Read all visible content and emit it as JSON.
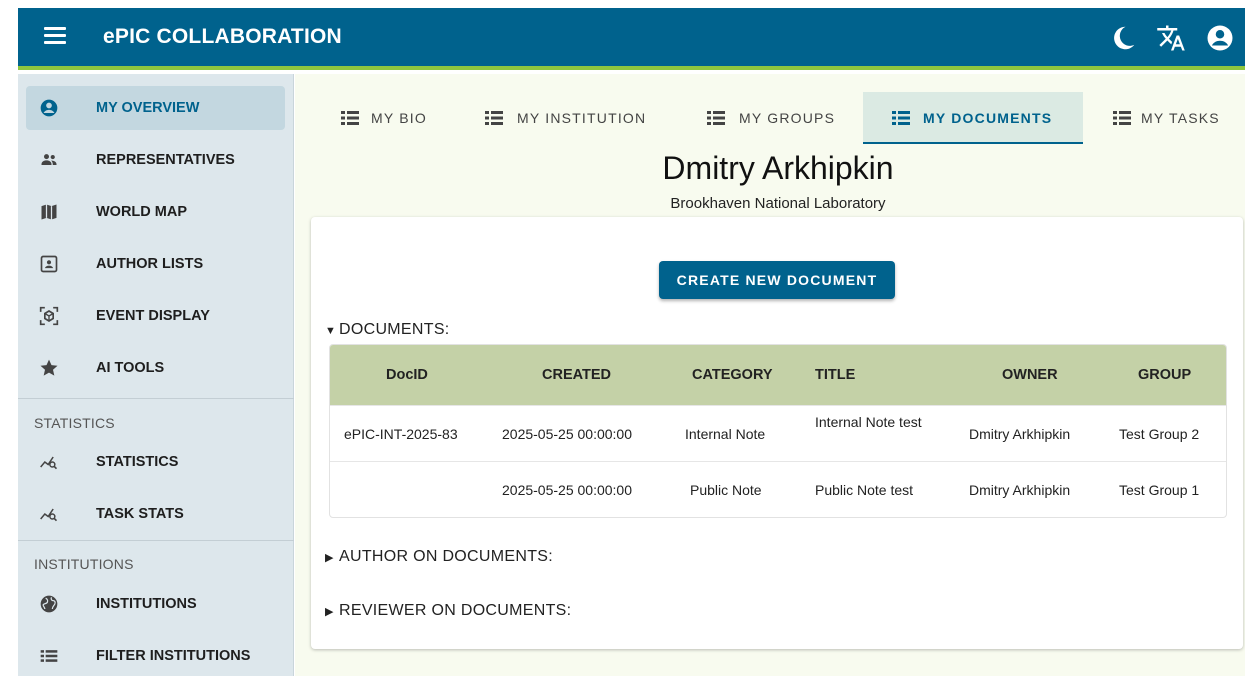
{
  "app": {
    "title": "ePIC COLLABORATION"
  },
  "topbar": {
    "icons": [
      "menu-icon",
      "moon-icon",
      "translate-icon",
      "account-icon"
    ]
  },
  "sidebar": {
    "items": [
      {
        "label": "MY OVERVIEW",
        "icon": "account-circle-icon",
        "active": true
      },
      {
        "label": "REPRESENTATIVES",
        "icon": "people-icon"
      },
      {
        "label": "WORLD MAP",
        "icon": "map-icon"
      },
      {
        "label": "AUTHOR LISTS",
        "icon": "contact-card-icon"
      },
      {
        "label": "EVENT DISPLAY",
        "icon": "cube-scan-icon"
      },
      {
        "label": "AI TOOLS",
        "icon": "star-icon"
      }
    ],
    "sections": [
      {
        "title": "STATISTICS",
        "items": [
          {
            "label": "STATISTICS",
            "icon": "chart-search-icon"
          },
          {
            "label": "TASK STATS",
            "icon": "chart-search-icon"
          }
        ]
      },
      {
        "title": "INSTITUTIONS",
        "items": [
          {
            "label": "INSTITUTIONS",
            "icon": "globe-icon"
          },
          {
            "label": "FILTER INSTITUTIONS",
            "icon": "list-icon"
          }
        ]
      }
    ]
  },
  "tabs": [
    {
      "label": "MY BIO"
    },
    {
      "label": "MY INSTITUTION"
    },
    {
      "label": "MY GROUPS"
    },
    {
      "label": "MY DOCUMENTS",
      "active": true
    },
    {
      "label": "MY TASKS"
    }
  ],
  "profile": {
    "name": "Dmitry Arkhipkin",
    "institution": "Brookhaven National Laboratory"
  },
  "documents": {
    "create_label": "CREATE NEW DOCUMENT",
    "section_label": "DOCUMENTS:",
    "columns": [
      "DocID",
      "CREATED",
      "CATEGORY",
      "TITLE",
      "OWNER",
      "GROUP"
    ],
    "rows": [
      {
        "docid": "ePIC-INT-2025-83",
        "created": "2025-05-25 00:00:00",
        "category": "Internal Note",
        "title": "Internal Note test",
        "owner": "Dmitry Arkhipkin",
        "group": "Test Group 2"
      },
      {
        "docid": "",
        "created": "2025-05-25 00:00:00",
        "category": "Public Note",
        "title": "Public Note test",
        "owner": "Dmitry Arkhipkin",
        "group": "Test Group 1"
      }
    ],
    "author_label": "AUTHOR ON DOCUMENTS:",
    "reviewer_label": "REVIEWER ON DOCUMENTS:"
  },
  "colors": {
    "primary": "#00628d",
    "accent": "#8dc63f",
    "table_header": "#c4d1a7",
    "sidebar": "#dde7ec"
  }
}
